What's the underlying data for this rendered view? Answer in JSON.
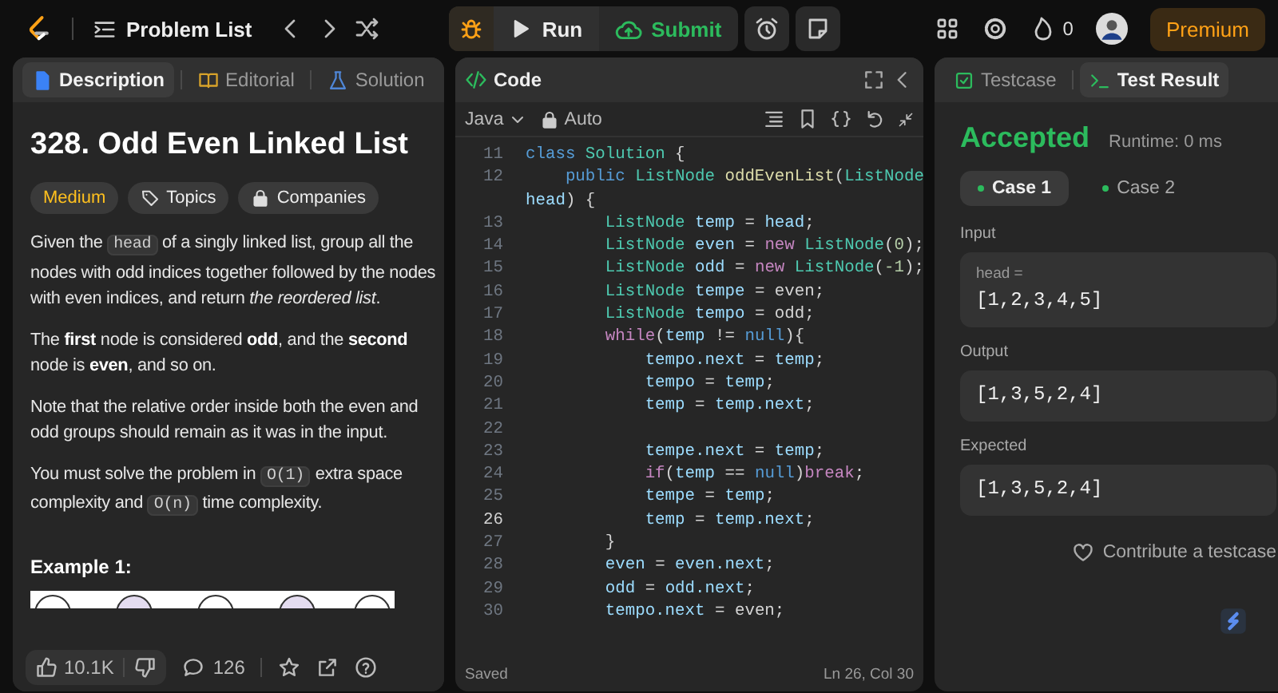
{
  "topbar": {
    "nav_label": "Problem List",
    "run_label": "Run",
    "submit_label": "Submit",
    "streak_count": "0",
    "premium_label": "Premium"
  },
  "description_panel": {
    "tabs": [
      {
        "label": "Description",
        "kind": "description",
        "selected": true
      },
      {
        "label": "Editorial",
        "kind": "editorial",
        "selected": false
      },
      {
        "label": "Solution",
        "kind": "solutions",
        "selected": false
      }
    ],
    "title": "328. Odd Even Linked List",
    "difficulty": {
      "label": "Medium",
      "kind": "medium"
    },
    "tags": [
      {
        "label": "Topics",
        "kind": "topics"
      },
      {
        "label": "Companies",
        "kind": "companies"
      }
    ],
    "paragraphs": [
      [
        {
          "kind": "text",
          "text": "Given the "
        },
        {
          "kind": "code",
          "text": "head"
        },
        {
          "kind": "text",
          "text": " of a singly linked list, group all the nodes with odd indices together followed by the nodes with even indices, and return *the reordered list*."
        }
      ],
      [
        {
          "kind": "text",
          "text": "The **first** node is considered **odd**, and the **second** node is **even**, and so on."
        }
      ],
      [
        {
          "kind": "text",
          "text": "Note that the relative order inside both the even and odd groups should remain as it was in the input."
        }
      ],
      [
        {
          "kind": "text",
          "text": "You must solve the problem in "
        },
        {
          "kind": "code",
          "text": "O(1)"
        },
        {
          "kind": "text",
          "text": " extra space complexity and "
        },
        {
          "kind": "code",
          "text": "O(n)"
        },
        {
          "kind": "text",
          "text": " time complexity."
        }
      ]
    ],
    "example_heading": "Example 1:",
    "likes": "10.1K",
    "comments": "126"
  },
  "code_panel": {
    "title": "Code",
    "language": "Java",
    "mode": "Auto",
    "lines": [
      {
        "number": "11",
        "current": false,
        "tokens": [
          {
            "text": "class",
            "kind": "keyword"
          },
          {
            "text": " Solution",
            "kind": "type"
          },
          {
            "text": " {",
            "kind": "plain"
          }
        ]
      },
      {
        "number": "12",
        "current": false,
        "tokens": [
          {
            "text": "    public",
            "kind": "keyword"
          },
          {
            "text": " ListNode",
            "kind": "type"
          },
          {
            "text": " oddEvenList",
            "kind": "function"
          },
          {
            "text": "(",
            "kind": "plain"
          },
          {
            "text": "ListNode",
            "kind": "type"
          }
        ]
      },
      {
        "tokens": [
          {
            "text": "head",
            "kind": "variable"
          },
          {
            "text": ") {",
            "kind": "plain"
          }
        ]
      },
      {
        "number": "13",
        "current": false,
        "tokens": [
          {
            "text": "        ListNode",
            "kind": "type"
          },
          {
            "text": " temp",
            "kind": "variable"
          },
          {
            "text": " =",
            "kind": "plain"
          },
          {
            "text": " head",
            "kind": "variable"
          },
          {
            "text": ";",
            "kind": "plain"
          }
        ]
      },
      {
        "number": "14",
        "current": false,
        "tokens": [
          {
            "text": "        ListNode",
            "kind": "type"
          },
          {
            "text": " even",
            "kind": "variable"
          },
          {
            "text": " =",
            "kind": "plain"
          },
          {
            "text": " new",
            "kind": "control"
          },
          {
            "text": " ListNode",
            "kind": "type"
          },
          {
            "text": "(",
            "kind": "plain"
          },
          {
            "text": "0",
            "kind": "number"
          },
          {
            "text": ");",
            "kind": "plain"
          }
        ]
      },
      {
        "number": "15",
        "current": false,
        "tokens": [
          {
            "text": "        ListNode",
            "kind": "type"
          },
          {
            "text": " odd",
            "kind": "variable"
          },
          {
            "text": " =",
            "kind": "plain"
          },
          {
            "text": " new",
            "kind": "control"
          },
          {
            "text": " ListNode",
            "kind": "type"
          },
          {
            "text": "(",
            "kind": "plain"
          },
          {
            "text": "-1",
            "kind": "number"
          },
          {
            "text": ");",
            "kind": "plain"
          }
        ]
      },
      {
        "number": "16",
        "current": false,
        "tokens": [
          {
            "text": "        ListNode",
            "kind": "type"
          },
          {
            "text": " tempe",
            "kind": "variable"
          },
          {
            "text": " = even;",
            "kind": "plain"
          }
        ]
      },
      {
        "number": "17",
        "current": false,
        "tokens": [
          {
            "text": "        ListNode",
            "kind": "type"
          },
          {
            "text": " tempo",
            "kind": "variable"
          },
          {
            "text": " = odd;",
            "kind": "plain"
          }
        ]
      },
      {
        "number": "18",
        "current": false,
        "tokens": [
          {
            "text": "        while",
            "kind": "control"
          },
          {
            "text": "(",
            "kind": "plain"
          },
          {
            "text": "temp",
            "kind": "variable"
          },
          {
            "text": " !=",
            "kind": "plain"
          },
          {
            "text": " null",
            "kind": "keyword"
          },
          {
            "text": "){",
            "kind": "plain"
          }
        ]
      },
      {
        "number": "19",
        "current": false,
        "tokens": [
          {
            "text": "            tempo.next",
            "kind": "variable"
          },
          {
            "text": " =",
            "kind": "plain"
          },
          {
            "text": " temp",
            "kind": "variable"
          },
          {
            "text": ";",
            "kind": "plain"
          }
        ]
      },
      {
        "number": "20",
        "current": false,
        "tokens": [
          {
            "text": "            tempo",
            "kind": "variable"
          },
          {
            "text": " =",
            "kind": "plain"
          },
          {
            "text": " temp",
            "kind": "variable"
          },
          {
            "text": ";",
            "kind": "plain"
          }
        ]
      },
      {
        "number": "21",
        "current": false,
        "tokens": [
          {
            "text": "            temp",
            "kind": "variable"
          },
          {
            "text": " =",
            "kind": "plain"
          },
          {
            "text": " temp.next",
            "kind": "variable"
          },
          {
            "text": ";",
            "kind": "plain"
          }
        ]
      },
      {
        "number": "22",
        "current": false
      },
      {
        "number": "23",
        "current": false,
        "tokens": [
          {
            "text": "            tempe.next",
            "kind": "variable"
          },
          {
            "text": " =",
            "kind": "plain"
          },
          {
            "text": " temp",
            "kind": "variable"
          },
          {
            "text": ";",
            "kind": "plain"
          }
        ]
      },
      {
        "number": "24",
        "current": false,
        "tokens": [
          {
            "text": "            if",
            "kind": "control"
          },
          {
            "text": "(",
            "kind": "plain"
          },
          {
            "text": "temp",
            "kind": "variable"
          },
          {
            "text": " ==",
            "kind": "plain"
          },
          {
            "text": " null",
            "kind": "keyword"
          },
          {
            "text": ")",
            "kind": "plain"
          },
          {
            "text": "break",
            "kind": "control"
          },
          {
            "text": ";",
            "kind": "plain"
          }
        ]
      },
      {
        "number": "25",
        "current": false,
        "tokens": [
          {
            "text": "            tempe",
            "kind": "variable"
          },
          {
            "text": " =",
            "kind": "plain"
          },
          {
            "text": " temp",
            "kind": "variable"
          },
          {
            "text": ";",
            "kind": "plain"
          }
        ]
      },
      {
        "number": "26",
        "current": true,
        "tokens": [
          {
            "text": "            temp",
            "kind": "variable"
          },
          {
            "text": " =",
            "kind": "plain"
          },
          {
            "text": " temp.next",
            "kind": "variable"
          },
          {
            "text": ";",
            "kind": "plain"
          }
        ]
      },
      {
        "number": "27",
        "current": false,
        "tokens": [
          {
            "text": "        }",
            "kind": "plain"
          }
        ]
      },
      {
        "number": "28",
        "current": false,
        "tokens": [
          {
            "text": "        even",
            "kind": "variable"
          },
          {
            "text": " =",
            "kind": "plain"
          },
          {
            "text": " even.next",
            "kind": "variable"
          },
          {
            "text": ";",
            "kind": "plain"
          }
        ]
      },
      {
        "number": "29",
        "current": false,
        "tokens": [
          {
            "text": "        odd",
            "kind": "variable"
          },
          {
            "text": " =",
            "kind": "plain"
          },
          {
            "text": " odd.next",
            "kind": "variable"
          },
          {
            "text": ";",
            "kind": "plain"
          }
        ]
      },
      {
        "number": "30",
        "current": false,
        "tokens": [
          {
            "text": "        tempo.next",
            "kind": "variable"
          },
          {
            "text": " =",
            "kind": "plain"
          },
          {
            "text": " even",
            "kind": "plain"
          },
          {
            "text": ";",
            "kind": "plain"
          }
        ]
      }
    ],
    "status": "Saved",
    "cursor": "Ln 26, Col 30"
  },
  "result_panel": {
    "tabs": [
      {
        "label": "Testcase",
        "kind": "testcase",
        "selected": false
      },
      {
        "label": "Test Result",
        "kind": "result",
        "selected": true
      }
    ],
    "verdict": "Accepted",
    "runtime": "Runtime: 0 ms",
    "cases": [
      {
        "label": "Case 1",
        "selected": true,
        "passed": true
      },
      {
        "label": "Case 2",
        "selected": false,
        "passed": true
      }
    ],
    "sections": [
      {
        "label": "Input",
        "param": "head =",
        "value": "[1,2,3,4,5]"
      },
      {
        "label": "Output",
        "value": "[1,3,5,2,4]"
      },
      {
        "label": "Expected",
        "value": "[1,3,5,2,4]"
      }
    ],
    "contribute": "Contribute a testcase"
  }
}
